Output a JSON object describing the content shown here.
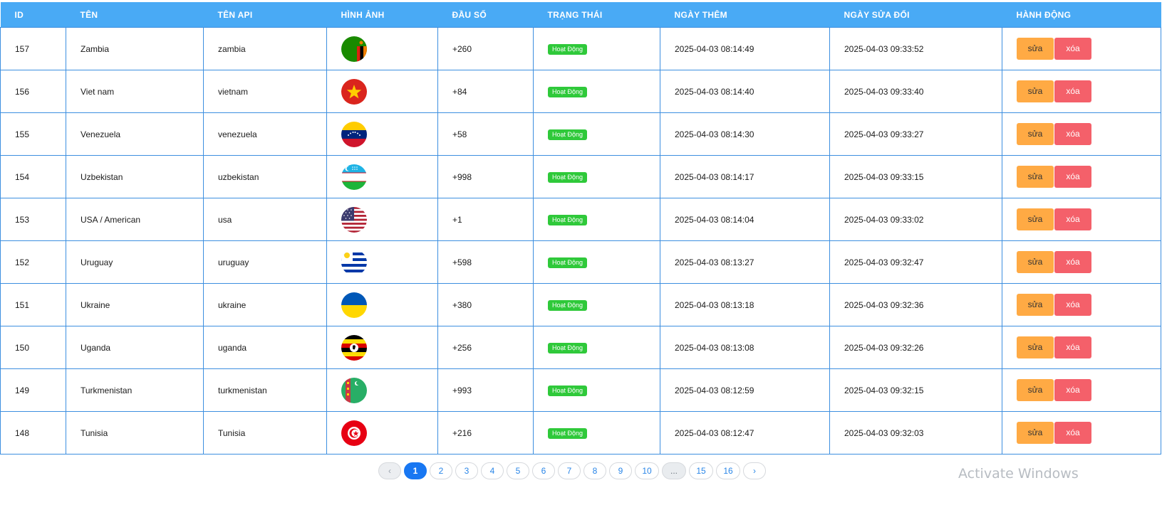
{
  "table": {
    "headers": {
      "id": "ID",
      "name": "TÊN",
      "api_name": "TÊN API",
      "image": "HÌNH ẢNH",
      "prefix": "ĐẦU SỐ",
      "status": "TRẠNG THÁI",
      "created": "NGÀY THÊM",
      "updated": "NGÀY SỬA ĐỔI",
      "actions": "HÀNH ĐỘNG"
    },
    "rows": [
      {
        "id": "157",
        "name": "Zambia",
        "api": "zambia",
        "flag": "zambia-flag-icon",
        "prefix": "+260",
        "status": "Hoạt Động",
        "created": "2025-04-03 08:14:49",
        "updated": "2025-04-03 09:33:52",
        "edit": "sửa",
        "delete": "xóa"
      },
      {
        "id": "156",
        "name": "Viet nam",
        "api": "vietnam",
        "flag": "vietnam-flag-icon",
        "prefix": "+84",
        "status": "Hoạt Động",
        "created": "2025-04-03 08:14:40",
        "updated": "2025-04-03 09:33:40",
        "edit": "sửa",
        "delete": "xóa"
      },
      {
        "id": "155",
        "name": "Venezuela",
        "api": "venezuela",
        "flag": "venezuela-flag-icon",
        "prefix": "+58",
        "status": "Hoạt Động",
        "created": "2025-04-03 08:14:30",
        "updated": "2025-04-03 09:33:27",
        "edit": "sửa",
        "delete": "xóa"
      },
      {
        "id": "154",
        "name": "Uzbekistan",
        "api": "uzbekistan",
        "flag": "uzbekistan-flag-icon",
        "prefix": "+998",
        "status": "Hoạt Động",
        "created": "2025-04-03 08:14:17",
        "updated": "2025-04-03 09:33:15",
        "edit": "sửa",
        "delete": "xóa"
      },
      {
        "id": "153",
        "name": "USA / American",
        "api": "usa",
        "flag": "usa-flag-icon",
        "prefix": "+1",
        "status": "Hoạt Động",
        "created": "2025-04-03 08:14:04",
        "updated": "2025-04-03 09:33:02",
        "edit": "sửa",
        "delete": "xóa"
      },
      {
        "id": "152",
        "name": "Uruguay",
        "api": "uruguay",
        "flag": "uruguay-flag-icon",
        "prefix": "+598",
        "status": "Hoạt Động",
        "created": "2025-04-03 08:13:27",
        "updated": "2025-04-03 09:32:47",
        "edit": "sửa",
        "delete": "xóa"
      },
      {
        "id": "151",
        "name": "Ukraine",
        "api": "ukraine",
        "flag": "ukraine-flag-icon",
        "prefix": "+380",
        "status": "Hoạt Động",
        "created": "2025-04-03 08:13:18",
        "updated": "2025-04-03 09:32:36",
        "edit": "sửa",
        "delete": "xóa"
      },
      {
        "id": "150",
        "name": "Uganda",
        "api": "uganda",
        "flag": "uganda-flag-icon",
        "prefix": "+256",
        "status": "Hoạt Động",
        "created": "2025-04-03 08:13:08",
        "updated": "2025-04-03 09:32:26",
        "edit": "sửa",
        "delete": "xóa"
      },
      {
        "id": "149",
        "name": "Turkmenistan",
        "api": "turkmenistan",
        "flag": "turkmenistan-flag-icon",
        "prefix": "+993",
        "status": "Hoạt Động",
        "created": "2025-04-03 08:12:59",
        "updated": "2025-04-03 09:32:15",
        "edit": "sửa",
        "delete": "xóa"
      },
      {
        "id": "148",
        "name": "Tunisia",
        "api": "Tunisia",
        "flag": "tunisia-flag-icon",
        "prefix": "+216",
        "status": "Hoạt Động",
        "created": "2025-04-03 08:12:47",
        "updated": "2025-04-03 09:32:03",
        "edit": "sửa",
        "delete": "xóa"
      }
    ]
  },
  "pagination": {
    "prev": "‹",
    "pages": [
      "1",
      "2",
      "3",
      "4",
      "5",
      "6",
      "7",
      "8",
      "9",
      "10"
    ],
    "ellipsis": "...",
    "last_pages": [
      "15",
      "16"
    ],
    "next": "›",
    "current": "1"
  },
  "watermark": "Activate Windows",
  "colors": {
    "header_bg": "#49aaf5",
    "border": "#3d8fe0",
    "status_green": "#2fc93a",
    "edit_orange": "#ffaa44",
    "delete_red": "#f4606a",
    "page_active": "#1877f2"
  }
}
